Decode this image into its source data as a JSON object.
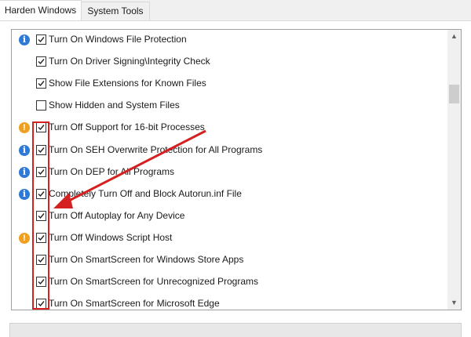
{
  "tabs": [
    {
      "label": "Harden Windows",
      "active": true
    },
    {
      "label": "System Tools",
      "active": false
    }
  ],
  "settings": [
    {
      "label": "Turn On Windows File Protection",
      "checked": true,
      "icon": "info-icon"
    },
    {
      "label": "Turn On Driver Signing\\Integrity Check",
      "checked": true,
      "icon": ""
    },
    {
      "label": "Show File Extensions for Known Files",
      "checked": true,
      "icon": ""
    },
    {
      "label": "Show Hidden and System Files",
      "checked": false,
      "icon": ""
    },
    {
      "label": "Turn Off Support for 16-bit Processes",
      "checked": true,
      "icon": "warning-icon"
    },
    {
      "label": "Turn On SEH Overwrite Protection for All Programs",
      "checked": true,
      "icon": "info-icon"
    },
    {
      "label": "Turn On DEP for All Programs",
      "checked": true,
      "icon": "info-icon"
    },
    {
      "label": "Completely Turn Off and Block Autorun.inf File",
      "checked": true,
      "icon": "info-icon"
    },
    {
      "label": "Turn Off Autoplay for Any Device",
      "checked": true,
      "icon": ""
    },
    {
      "label": "Turn Off Windows Script Host",
      "checked": true,
      "icon": "warning-icon"
    },
    {
      "label": "Turn On SmartScreen for Windows Store Apps",
      "checked": true,
      "icon": ""
    },
    {
      "label": "Turn On SmartScreen for Unrecognized Programs",
      "checked": true,
      "icon": ""
    },
    {
      "label": "Turn On SmartScreen for Microsoft Edge",
      "checked": true,
      "icon": ""
    }
  ],
  "icons": {
    "info_glyph": "i",
    "warning_glyph": "!"
  },
  "colors": {
    "info": "#2f7ad6",
    "warning": "#f0a020",
    "highlight": "#d42020"
  }
}
